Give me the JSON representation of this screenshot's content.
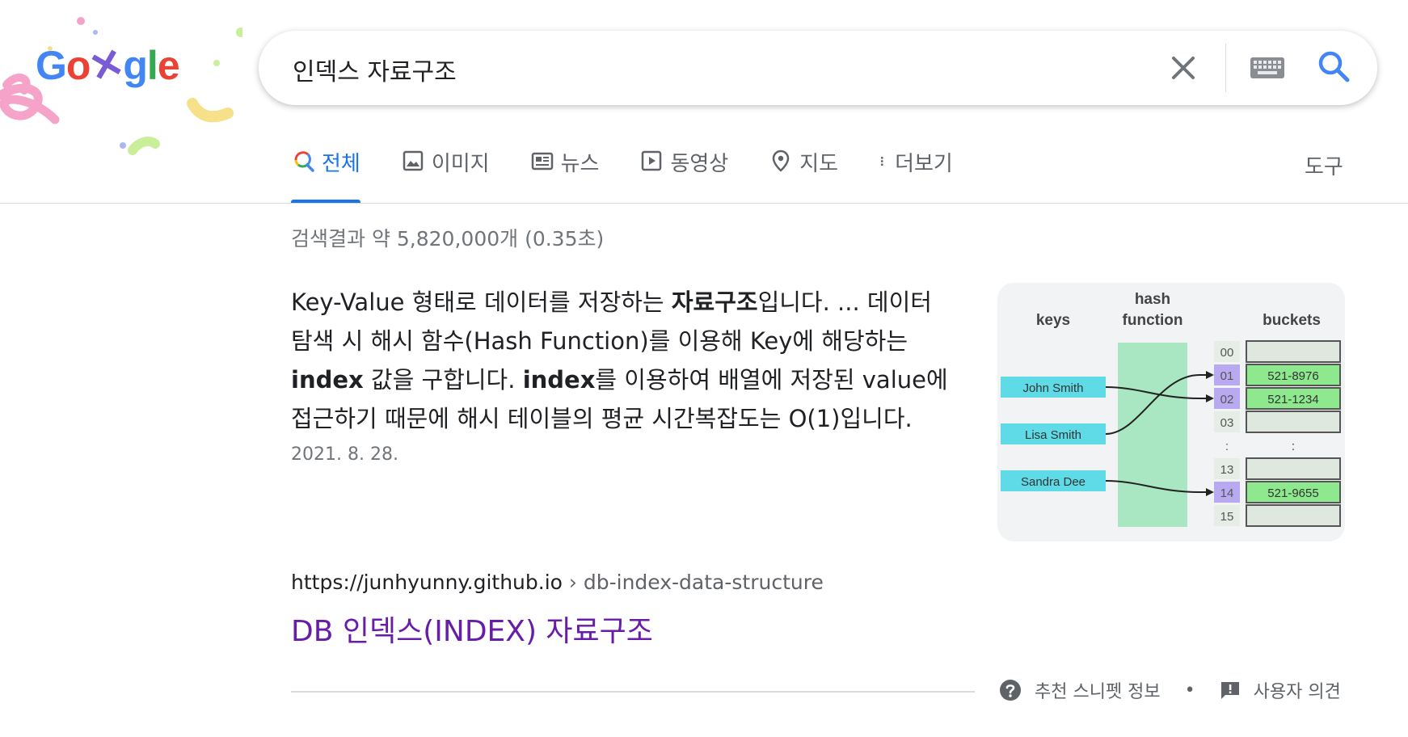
{
  "logo": {
    "text": "Google"
  },
  "search": {
    "query": "인덱스 자료구조"
  },
  "tabs": [
    {
      "label": "전체",
      "icon": "search-icon",
      "active": true
    },
    {
      "label": "이미지",
      "icon": "image-icon",
      "active": false
    },
    {
      "label": "뉴스",
      "icon": "news-icon",
      "active": false
    },
    {
      "label": "동영상",
      "icon": "video-icon",
      "active": false
    },
    {
      "label": "지도",
      "icon": "map-pin-icon",
      "active": false
    },
    {
      "label": "더보기",
      "icon": "more-vert-icon",
      "active": false
    }
  ],
  "tools_label": "도구",
  "result_stats": "검색결과 약 5,820,000개 (0.35초)",
  "featured_snippet": {
    "part1": "Key-Value 형태로 데이터를 저장하는 ",
    "bold1": "자료구조",
    "part2": "입니다. ... 데이터 탐색 시 해시 함수(Hash Function)를 이용해 Key에 해당하는 ",
    "bold2": "index",
    "part3": " 값을 구합니다. ",
    "bold3": "index",
    "part4": "를 이용하여 배열에 저장된 value에 접근하기 때문에 해시 테이블의 평균 시간복잡도는 O(1)입니다.",
    "date": "2021. 8. 28."
  },
  "diagram": {
    "headers": {
      "keys": "keys",
      "hash1": "hash",
      "hash2": "function",
      "buckets": "buckets"
    },
    "keys": [
      "John Smith",
      "Lisa Smith",
      "Sandra Dee"
    ],
    "bucket_indices": [
      "00",
      "01",
      "02",
      "03",
      ":",
      "13",
      "14",
      "15"
    ],
    "bucket_values": [
      "",
      "521-8976",
      "521-1234",
      "",
      ":",
      "",
      "521-9655",
      ""
    ]
  },
  "result": {
    "url_host": "https://junhyunny.github.io",
    "url_path": " › db-index-data-structure",
    "title": "DB 인덱스(INDEX) 자료구조"
  },
  "footer": {
    "about_label": "추천 스니펫 정보",
    "separator": "•",
    "feedback_label": "사용자 의견"
  },
  "colors": {
    "accent_blue": "#1a73e8",
    "visited_purple": "#681da8",
    "diagram_key": "#5fdbe8",
    "diagram_hash": "#a9e6c2",
    "diagram_index_hl": "#b9a9f0",
    "diagram_value": "#8ee88e"
  }
}
